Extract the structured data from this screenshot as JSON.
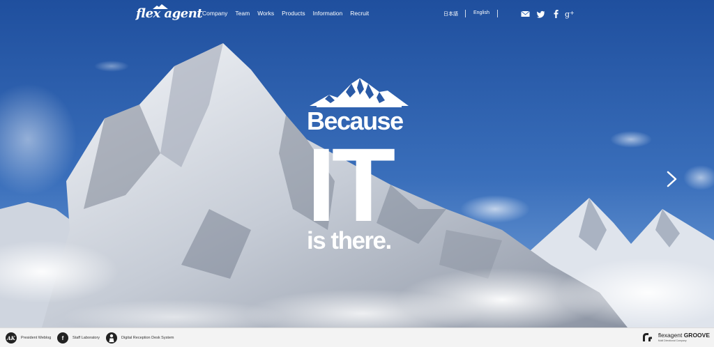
{
  "header": {
    "logo_text": "flex agent",
    "nav": [
      {
        "label": "Company"
      },
      {
        "label": "Team"
      },
      {
        "label": "Works"
      },
      {
        "label": "Products"
      },
      {
        "label": "Information"
      },
      {
        "label": "Recruit"
      }
    ],
    "languages": [
      {
        "label": "日本語"
      },
      {
        "label": "English"
      }
    ],
    "social": [
      {
        "icon": "mail-icon"
      },
      {
        "icon": "twitter-icon"
      },
      {
        "icon": "facebook-icon"
      },
      {
        "icon": "google-plus-icon"
      }
    ]
  },
  "hero": {
    "line1": "Because",
    "line2": "IT",
    "line3": "is there.",
    "next_icon": "chevron-right-icon"
  },
  "footer": {
    "links": [
      {
        "icon_text": "AK",
        "label": "President Weblog"
      },
      {
        "icon_text": "f",
        "label": "Staff Laboratory"
      },
      {
        "icon_text": "",
        "label": "Digital Reception Desk System"
      }
    ],
    "groove_brand": "flexagent",
    "groove_name": "GROOVE",
    "groove_tagline": "Multi Directional Company"
  },
  "colors": {
    "sky_top": "#2150a0",
    "sky_bottom": "#5a8fd0",
    "snow": "#ffffff",
    "footer_bg": "#f3f3f3"
  }
}
